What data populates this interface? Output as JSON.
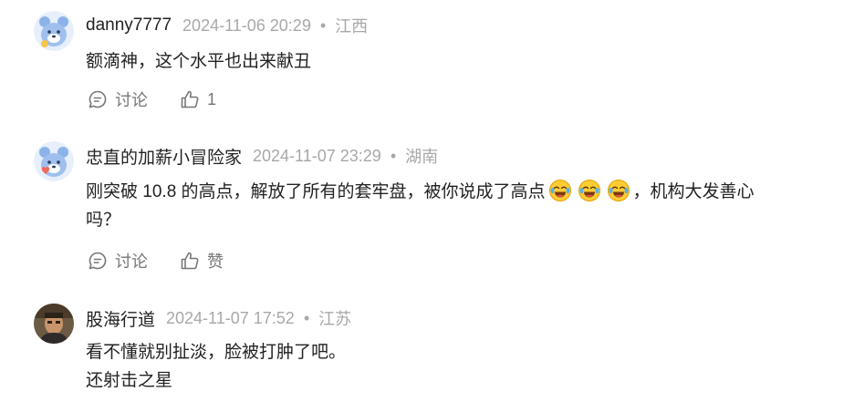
{
  "comments": [
    {
      "username": "danny7777",
      "datetime": "2024-11-06 20:29",
      "separator": "•",
      "region": "江西",
      "line1": "额滴神，这个水平也出来献丑",
      "reply_label": "讨论",
      "like_label": "1"
    },
    {
      "username": "忠直的加薪小冒险家",
      "datetime": "2024-11-07 23:29",
      "separator": "•",
      "region": "湖南",
      "line1_part1": "刚突破 10.8 的高点，解放了所有的套牢盘，被你说成了高点",
      "line1_part2": "，机构大发善心",
      "line2": "吗？",
      "emoji_name": "laugh-cry-emoji",
      "reply_label": "讨论",
      "like_label": "赞"
    },
    {
      "username": "股海行道",
      "datetime": "2024-11-07 17:52",
      "separator": "•",
      "region": "江苏",
      "line1": "看不懂就别扯淡，脸被打肿了吧。",
      "line2": "还射击之星"
    }
  ],
  "colors": {
    "text": "#222222",
    "meta": "#a8a8a8",
    "action": "#777777",
    "avatar_bear": "#8bb3ea"
  }
}
